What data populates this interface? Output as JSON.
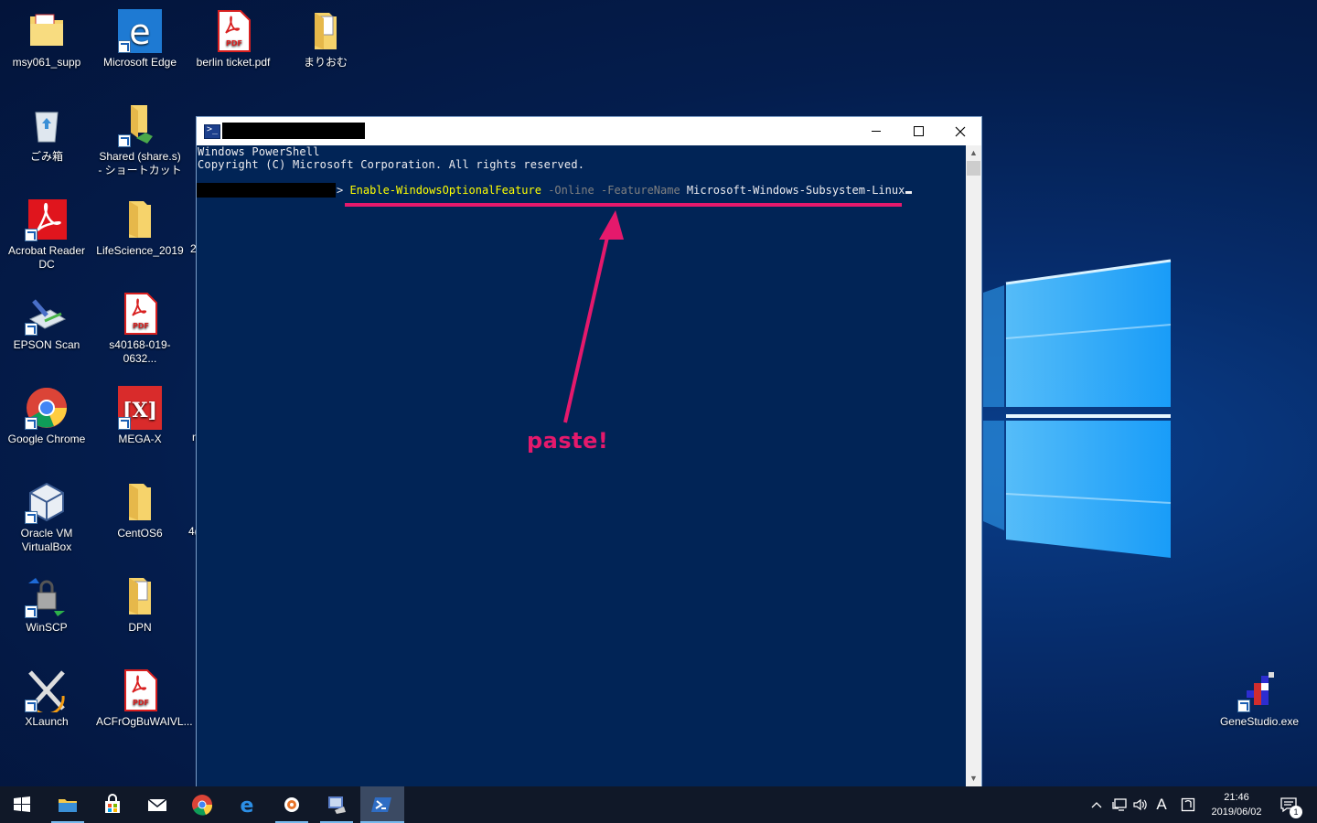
{
  "desktop": {
    "icons": [
      {
        "label": "msy061_supp",
        "icon": "folder-pdf-icon"
      },
      {
        "label": "Microsoft Edge",
        "icon": "edge-icon"
      },
      {
        "label": "berlin ticket.pdf",
        "icon": "pdf-icon"
      },
      {
        "label": "まりおむ",
        "icon": "folder-doc-icon"
      },
      {
        "label": "ごみ箱",
        "icon": "recycle-bin-icon"
      },
      {
        "label": "Shared (share.s) - ショートカット",
        "icon": "folder-share-icon"
      },
      {
        "label": "Acrobat Reader DC",
        "icon": "acrobat-icon"
      },
      {
        "label": "LifeScience_2019",
        "icon": "folder-icon"
      },
      {
        "label": "EPSON Scan",
        "icon": "scanner-icon"
      },
      {
        "label": "s40168-019-0632...",
        "icon": "pdf-icon"
      },
      {
        "label": "Google Chrome",
        "icon": "chrome-icon"
      },
      {
        "label": "MEGA-X",
        "icon": "megax-icon"
      },
      {
        "label": "Oracle VM VirtualBox",
        "icon": "virtualbox-icon"
      },
      {
        "label": "CentOS6",
        "icon": "folder-icon"
      },
      {
        "label": "WinSCP",
        "icon": "winscp-icon"
      },
      {
        "label": "DPN",
        "icon": "folder-doc-icon"
      },
      {
        "label": "XLaunch",
        "icon": "xlaunch-icon"
      },
      {
        "label": "ACFrOgBuWAIVL...",
        "icon": "pdf-icon"
      },
      {
        "label": "GeneStudio.exe",
        "icon": "genestudio-icon"
      }
    ],
    "partial_labels": [
      "2(",
      "n",
      "4("
    ]
  },
  "powershell": {
    "title": "",
    "banner_line1": "Windows PowerShell",
    "banner_line2": "Copyright (C) Microsoft Corporation. All rights reserved.",
    "prompt_symbol": "> ",
    "command": "Enable-WindowsOptionalFeature",
    "param1": " -Online",
    "param2": " -FeatureName",
    "argument": " Microsoft-Windows-Subsystem-Linux",
    "buttons": {
      "minimize": "minimize",
      "maximize": "maximize",
      "close": "close"
    }
  },
  "annotation": {
    "label": "paste!",
    "color": "#e5196c"
  },
  "taskbar": {
    "apps": [
      "start",
      "file-explorer",
      "store",
      "mail",
      "chrome",
      "edge",
      "app-orange",
      "app-scan",
      "powershell"
    ],
    "ime_indicator": "A",
    "time": "21:46",
    "date": "2019/06/02",
    "notification_count": "1"
  }
}
